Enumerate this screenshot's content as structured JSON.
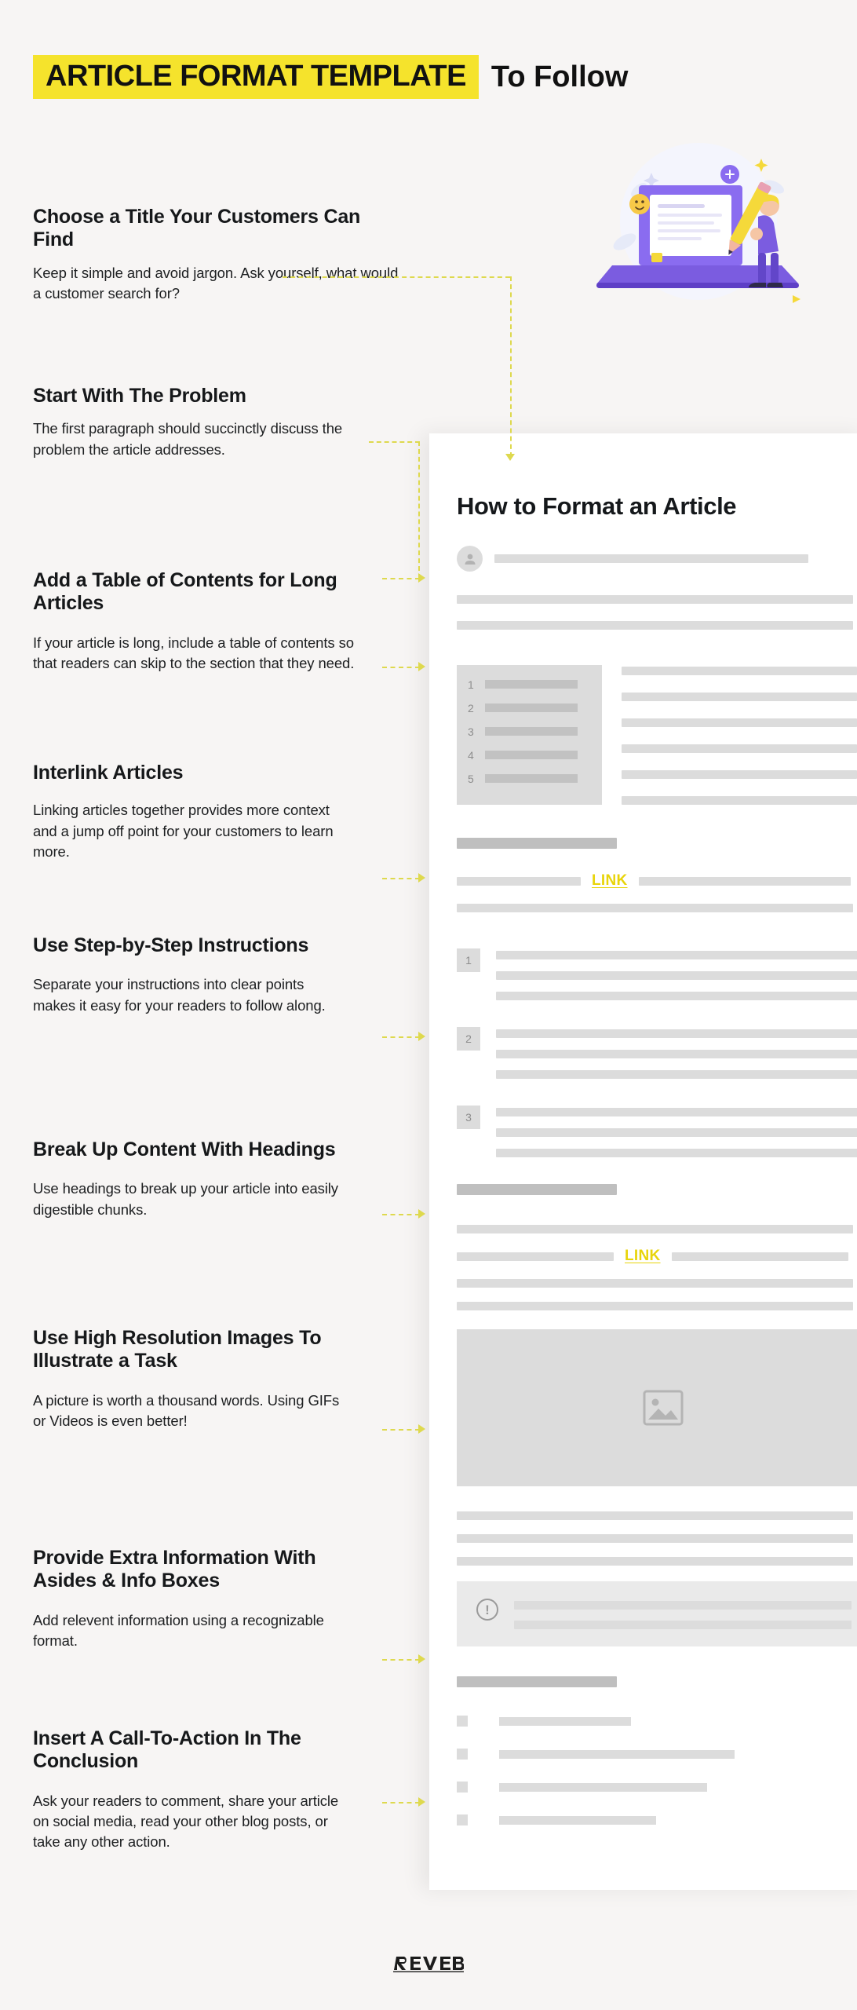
{
  "header": {
    "highlight_text": "ARTICLE  FORMAT TEMPLATE",
    "plain_text": "To Follow",
    "highlight_color": "#f5e32c"
  },
  "steps": [
    {
      "title": "Choose a Title Your Customers Can Find",
      "body": "Keep it simple and avoid jargon. Ask yourself, what would a customer search for?"
    },
    {
      "title": "Start With The Problem",
      "body": "The first paragraph should succinctly discuss the problem the article addresses."
    },
    {
      "title": "Add a Table of Contents for Long Articles",
      "body": "If your article is long, include a table of contents so that readers can skip to the section that they need."
    },
    {
      "title": "Interlink Articles",
      "body": "Linking articles together provides more context and a jump off point for your customers to learn more."
    },
    {
      "title": "Use Step-by-Step Instructions",
      "body": "Separate your instructions into clear points makes it easy for your readers to follow along."
    },
    {
      "title": "Break Up Content With Headings",
      "body": "Use headings to break up your article into easily digestible chunks."
    },
    {
      "title": "Use High Resolution Images To Illustrate a Task",
      "body": "A picture is worth a thousand words. Using GIFs or Videos is even better!"
    },
    {
      "title": "Provide Extra Information With Asides & Info Boxes",
      "body": "Add relevent information using a recognizable format."
    },
    {
      "title": "Insert A Call-To-Action In The Conclusion",
      "body": "Ask your readers to comment, share your article on social media, read your other blog posts, or take any other action."
    }
  ],
  "mockup": {
    "title": "How to Format an Article",
    "toc_numbers": [
      "1",
      "2",
      "3",
      "4",
      "5"
    ],
    "step_numbers": [
      "1",
      "2",
      "3"
    ],
    "link_label_1": "LINK",
    "link_label_2": "LINK",
    "info_icon": "!"
  },
  "footer": {
    "brand": "REVERB"
  },
  "colors": {
    "background": "#f7f5f4",
    "accent_yellow": "#f5e32c",
    "arrow_yellow": "#ded94e",
    "link_yellow": "#e8d40a",
    "placeholder_gray": "#dcdcdc",
    "heading_black": "#16181a",
    "illustration_purple": "#6c4bd8"
  }
}
